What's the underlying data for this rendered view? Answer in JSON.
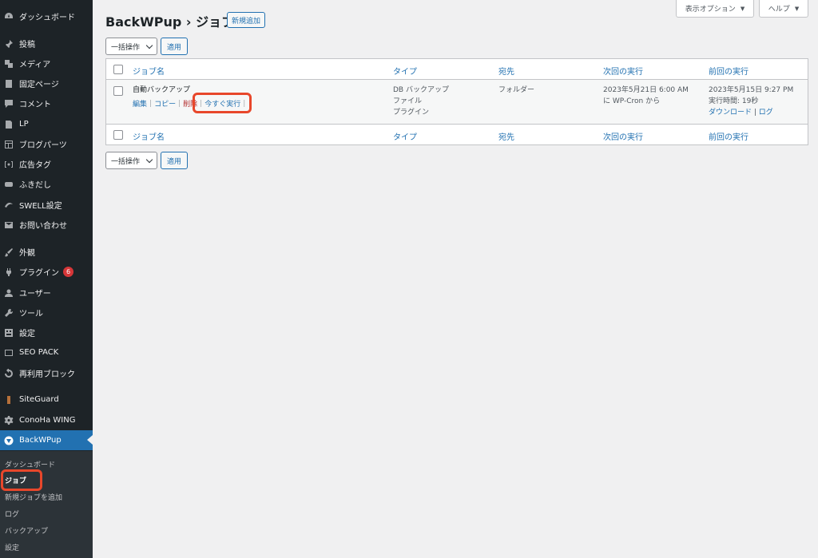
{
  "sidebar": {
    "items": [
      {
        "label": "ダッシュボード",
        "icon": "dashboard-icon"
      },
      {
        "label": "投稿",
        "icon": "pin-icon"
      },
      {
        "label": "メディア",
        "icon": "media-icon"
      },
      {
        "label": "固定ページ",
        "icon": "page-icon"
      },
      {
        "label": "コメント",
        "icon": "comment-icon"
      },
      {
        "label": "LP",
        "icon": "document-icon"
      },
      {
        "label": "ブログパーツ",
        "icon": "layout-icon"
      },
      {
        "label": "広告タグ",
        "icon": "ad-icon"
      },
      {
        "label": "ふきだし",
        "icon": "balloon-icon"
      },
      {
        "label": "SWELL設定",
        "icon": "swell-icon"
      },
      {
        "label": "お問い合わせ",
        "icon": "mail-icon"
      },
      {
        "label": "外観",
        "icon": "brush-icon"
      },
      {
        "label": "プラグイン",
        "icon": "plugin-icon",
        "badge": "6"
      },
      {
        "label": "ユーザー",
        "icon": "user-icon"
      },
      {
        "label": "ツール",
        "icon": "wrench-icon"
      },
      {
        "label": "設定",
        "icon": "settings-icon"
      },
      {
        "label": "SEO PACK",
        "icon": "seo-icon"
      },
      {
        "label": "再利用ブロック",
        "icon": "reuse-icon"
      },
      {
        "label": "SiteGuard",
        "icon": "siteguard-icon"
      },
      {
        "label": "ConoHa WING",
        "icon": "gear-icon"
      },
      {
        "label": "BackWPup",
        "icon": "backwpup-icon"
      }
    ],
    "submenu": [
      "ダッシュボード",
      "ジョブ",
      "新規ジョブを追加",
      "ログ",
      "バックアップ",
      "設定"
    ]
  },
  "screen_options": "表示オプション",
  "help": "ヘルプ",
  "page": {
    "title": "BackWPup › ジョブ",
    "add_new": "新規追加",
    "bulk_action": "一括操作",
    "apply": "適用"
  },
  "table": {
    "columns": [
      "ジョブ名",
      "タイプ",
      "宛先",
      "次回の実行",
      "前回の実行"
    ],
    "rows": [
      {
        "name": "自動バックアップ",
        "actions": {
          "edit": "編集",
          "copy": "コピー",
          "delete": "削除",
          "run_now": "今すぐ実行"
        },
        "type_lines": [
          "DB バックアップ",
          "ファイル",
          "プラグイン"
        ],
        "destination": "フォルダー",
        "next_run": [
          "2023年5月21日 6:00 AM",
          "に WP-Cron から"
        ],
        "last_run": {
          "date": "2023年5月15日 9:27 PM",
          "runtime": "実行時間: 19秒",
          "download": "ダウンロード",
          "log": "ログ"
        }
      }
    ]
  },
  "colors": {
    "sidebar_bg": "#1d2327",
    "accent": "#2271b1",
    "highlight": "#e8472b",
    "badge": "#d63638"
  }
}
